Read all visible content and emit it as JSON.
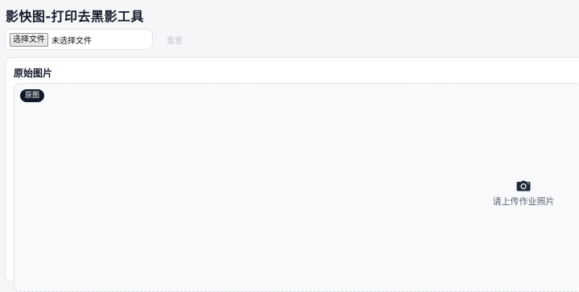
{
  "app": {
    "title": "影快图-打印去黑影工具"
  },
  "toolbar": {
    "file_button_label": "选择文件",
    "file_status": "未选择文件",
    "reset_label": "重置"
  },
  "panel": {
    "title": "原始图片",
    "badge": "原图",
    "placeholder_icon": "camera-icon",
    "placeholder_text": "请上传作业照片"
  },
  "colors": {
    "background": "#f5f6f8",
    "panel": "#ffffff",
    "badge": "#111827",
    "muted_text": "#5b6473",
    "disabled_text": "#c4c8cf"
  }
}
